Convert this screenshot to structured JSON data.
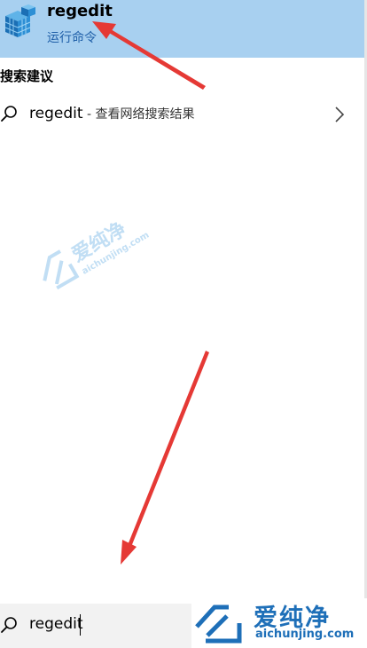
{
  "best_match": {
    "title": "regedit",
    "subtitle": "运行命令",
    "icon": "registry-editor-icon"
  },
  "suggestions_header": "搜索建议",
  "suggestion": {
    "query": "regedit",
    "suffix": " - 查看网络搜索结果",
    "icon": "search-icon",
    "chevron": "chevron-right-icon"
  },
  "search_box": {
    "value": "regedit",
    "icon": "search-icon"
  },
  "watermark": {
    "brand_cn": "爱纯净",
    "url": "aichunjing.com"
  },
  "colors": {
    "highlight": "#a8d0f0",
    "arrow": "#e53935",
    "brand": "#1e6fb8"
  }
}
